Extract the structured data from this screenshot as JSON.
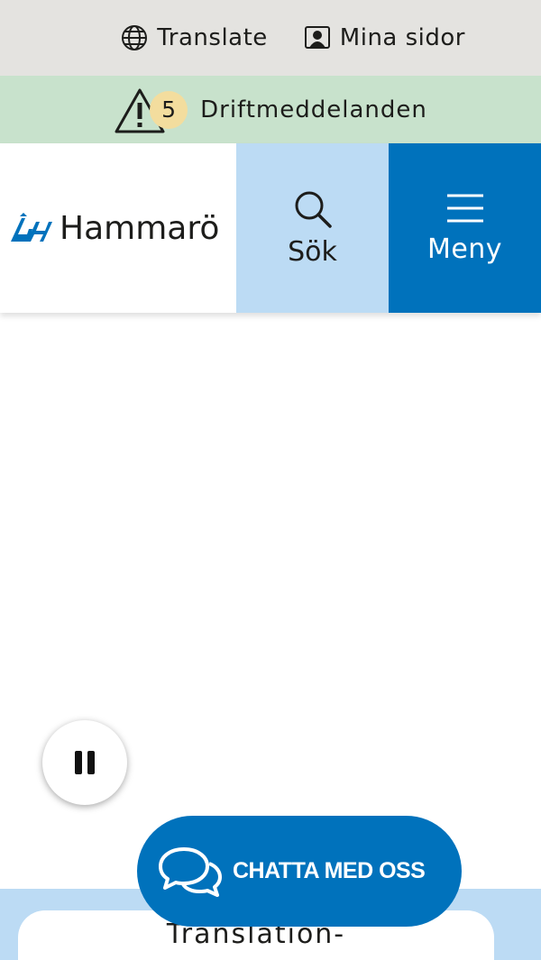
{
  "utility": {
    "translate_label": "Translate",
    "my_pages_label": "Mina sidor"
  },
  "alerts": {
    "count": "5",
    "label": "Driftmeddelanden"
  },
  "header": {
    "logo_text": "Hammarö",
    "search_label": "Sök",
    "menu_label": "Meny"
  },
  "chat": {
    "label": "CHATTA MED OSS"
  },
  "translate_widget": {
    "text": "Translation-"
  },
  "colors": {
    "brand_blue": "#0072bc",
    "light_blue": "#bcdbf4",
    "alert_green": "#c8e2cc",
    "utility_grey": "#e4e3e0"
  },
  "icons": {
    "translate": "globe-icon",
    "my_pages": "user-card-icon",
    "alerts": "warning-icon",
    "search": "search-icon",
    "menu": "hamburger-icon",
    "pause": "pause-icon",
    "chat": "chat-bubbles-icon"
  }
}
